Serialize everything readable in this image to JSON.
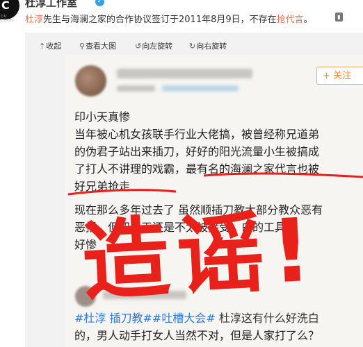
{
  "header": {
    "author": "杜淳工作室",
    "avatar_text": "C",
    "avatar_subtext": "DU CHUN",
    "post_pre": "杜淳",
    "post_mid": "先生与海澜之家的合作协议签订于2011年8月9日，不存在",
    "post_link": "抢代言",
    "post_post": "。"
  },
  "toolbar": {
    "collapse": "收起",
    "view_large": "查看大图",
    "rotate_left": "向左旋转",
    "rotate_right": "向右旋转"
  },
  "screenshot": {
    "follow": "+ 关注",
    "lines": [
      "印小天真惨",
      "当年被心机女孩联手行业大佬搞，被曾经称兄道弟",
      "的伪君子站出来插刀，好好的阳光流量小生被搞成",
      "了打人不讲理的戏霸，最有名的海澜之家代言也被",
      "好兄弟抢走",
      "现在那么多年过去了 虽然顺插刀教大部分教众恶有",
      "恶报，但印小天还是不太被接受，白的工具",
      "好惨"
    ],
    "hashtag1": "#杜淳 插刀教#",
    "hashtag2": "#吐槽大会#",
    "line_after_tags": " 杜淳这有什么好洗白",
    "last_line": "的，男人动手打女人当然不对，但是人家打了么？",
    "stamp": "造谣!"
  },
  "colors": {
    "accent": "#eb7350",
    "stamp_red": "#e8221b",
    "link_blue": "#2c7ad6"
  }
}
